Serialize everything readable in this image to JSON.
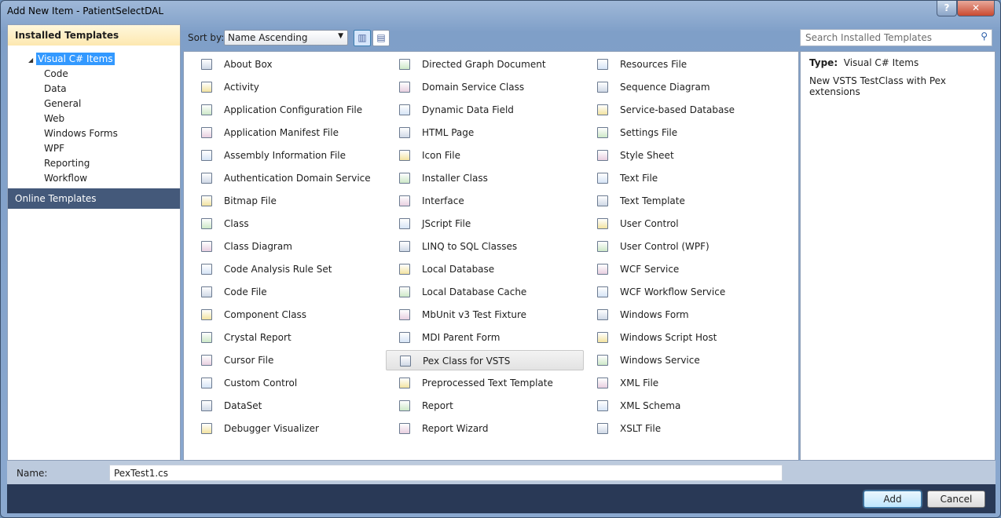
{
  "window": {
    "title": "Add New Item - PatientSelectDAL",
    "help": "?",
    "close": "✕"
  },
  "left": {
    "header": "Installed Templates",
    "root": "Visual C# Items",
    "children": [
      "Code",
      "Data",
      "General",
      "Web",
      "Windows Forms",
      "WPF",
      "Reporting",
      "Workflow"
    ],
    "online": "Online Templates"
  },
  "toolbar": {
    "sort_label": "Sort by:",
    "sort_value": "Name Ascending"
  },
  "search": {
    "placeholder": "Search Installed Templates"
  },
  "selected_item": "Pex Class for VSTS",
  "items": [
    [
      "About Box",
      "Activity",
      "Application Configuration File",
      "Application Manifest File",
      "Assembly Information File",
      "Authentication Domain Service",
      "Bitmap File",
      "Class",
      "Class Diagram",
      "Code Analysis Rule Set",
      "Code File",
      "Component Class",
      "Crystal Report",
      "Cursor File",
      "Custom Control",
      "DataSet",
      "Debugger Visualizer"
    ],
    [
      "Directed Graph Document",
      "Domain Service Class",
      "Dynamic Data Field",
      "HTML Page",
      "Icon File",
      "Installer Class",
      "Interface",
      "JScript File",
      "LINQ to SQL Classes",
      "Local Database",
      "Local Database Cache",
      "MbUnit v3 Test Fixture",
      "MDI Parent Form",
      "Pex Class for VSTS",
      "Preprocessed Text Template",
      "Report",
      "Report Wizard"
    ],
    [
      "Resources File",
      "Sequence Diagram",
      "Service-based Database",
      "Settings File",
      "Style Sheet",
      "Text File",
      "Text Template",
      "User Control",
      "User Control (WPF)",
      "WCF Service",
      "WCF Workflow Service",
      "Windows Form",
      "Windows Script Host",
      "Windows Service",
      "XML File",
      "XML Schema",
      "XSLT File"
    ]
  ],
  "details": {
    "type_label": "Type:",
    "type_value": "Visual C# Items",
    "description": "New VSTS TestClass with Pex extensions"
  },
  "name": {
    "label": "Name:",
    "value": "PexTest1.cs"
  },
  "buttons": {
    "add": "Add",
    "cancel": "Cancel"
  }
}
